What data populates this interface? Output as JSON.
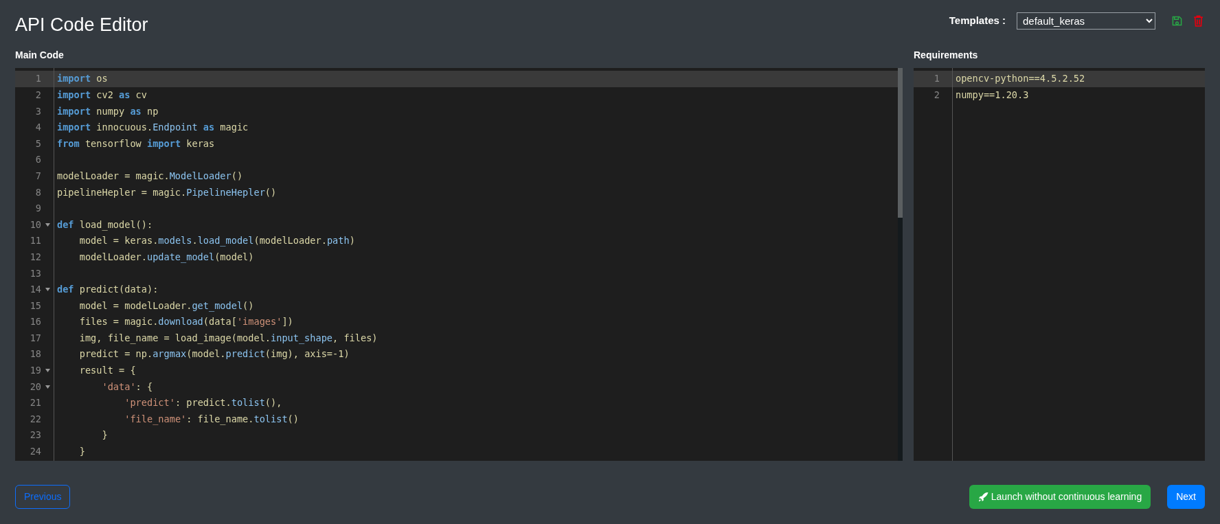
{
  "title": "API Code Editor",
  "templates": {
    "label": "Templates :",
    "value": "default_keras"
  },
  "main_code": {
    "label": "Main Code",
    "lines": [
      {
        "n": "1",
        "selected": true,
        "foldable": false,
        "text": "**import** os"
      },
      {
        "n": "2",
        "selected": false,
        "foldable": false,
        "text": "**import** cv2 **as** cv"
      },
      {
        "n": "3",
        "selected": false,
        "foldable": false,
        "text": "**import** numpy **as** np"
      },
      {
        "n": "4",
        "selected": false,
        "foldable": false,
        "text": "**import** innocuous.Endpoint **as** magic"
      },
      {
        "n": "5",
        "selected": false,
        "foldable": false,
        "text": "**from** tensorflow **import** keras"
      },
      {
        "n": "6",
        "selected": false,
        "foldable": false
      },
      {
        "n": "7",
        "selected": false,
        "foldable": false,
        "text": "modelLoader = magic.ModelLoader()"
      },
      {
        "n": "8",
        "selected": false,
        "foldable": false,
        "text": "pipelineHepler = magic.PipelineHepler()"
      },
      {
        "n": "9",
        "selected": false,
        "foldable": false
      },
      {
        "n": "10",
        "selected": false,
        "foldable": true,
        "text": "**def** load_model():"
      },
      {
        "n": "11",
        "selected": false,
        "foldable": false,
        "text": "    model = keras.models.load_model(modelLoader.path)"
      },
      {
        "n": "12",
        "selected": false,
        "foldable": false,
        "text": "    modelLoader.update_model(model)"
      },
      {
        "n": "13",
        "selected": false,
        "foldable": false
      },
      {
        "n": "14",
        "selected": false,
        "foldable": true,
        "text": "**def** predict(data):"
      },
      {
        "n": "15",
        "selected": false,
        "foldable": false,
        "text": "    model = modelLoader.get_model()"
      },
      {
        "n": "16",
        "selected": false,
        "foldable": false,
        "text": "    files = magic.download(data['images'])"
      },
      {
        "n": "17",
        "selected": false,
        "foldable": false,
        "text": "    img, file_name = load_image(model.input_shape, files)"
      },
      {
        "n": "18",
        "selected": false,
        "foldable": false,
        "text": "    predict = np.argmax(model.predict(img), axis=-1)"
      },
      {
        "n": "19",
        "selected": false,
        "foldable": true,
        "text": "    result = {"
      },
      {
        "n": "20",
        "selected": false,
        "foldable": true,
        "text": "        'data': {"
      },
      {
        "n": "21",
        "selected": false,
        "foldable": false,
        "text": "            'predict': predict.tolist(),"
      },
      {
        "n": "22",
        "selected": false,
        "foldable": false,
        "text": "            'file_name': file_name.tolist()"
      },
      {
        "n": "23",
        "selected": false,
        "foldable": false,
        "text": "        }"
      },
      {
        "n": "24",
        "selected": false,
        "foldable": false,
        "text": "    }"
      }
    ]
  },
  "requirements": {
    "label": "Requirements",
    "lines": [
      {
        "n": "1",
        "selected": true,
        "foldable": false,
        "text": "opencv-python==4.5.2.52"
      },
      {
        "n": "2",
        "selected": false,
        "foldable": false,
        "text": "numpy==1.20.3"
      }
    ]
  },
  "buttons": {
    "previous": "Previous",
    "launch": "Launch without continuous learning",
    "next": "Next"
  }
}
